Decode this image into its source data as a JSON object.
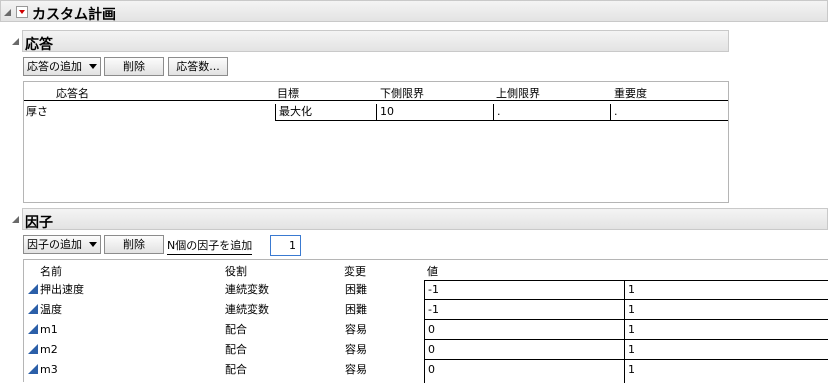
{
  "main": {
    "title": "カスタム計画"
  },
  "responses": {
    "title": "応答",
    "buttons": {
      "add": "応答の追加",
      "delete": "削除",
      "count": "応答数..."
    },
    "columns": [
      "応答名",
      "目標",
      "下側限界",
      "上側限界",
      "重要度"
    ],
    "rows": [
      {
        "name": "厚さ",
        "goal": "最大化",
        "lower": "10",
        "upper": ".",
        "importance": "."
      }
    ]
  },
  "factors": {
    "title": "因子",
    "buttons": {
      "add": "因子の追加",
      "delete": "削除",
      "add_n": "N個の因子を追加"
    },
    "n_value": "1",
    "columns": [
      "名前",
      "役割",
      "変更",
      "値"
    ],
    "rows": [
      {
        "name": "押出速度",
        "role": "連続変数",
        "change": "困難",
        "low": "-1",
        "high": "1"
      },
      {
        "name": "温度",
        "role": "連続変数",
        "change": "困難",
        "low": "-1",
        "high": "1"
      },
      {
        "name": "m1",
        "role": "配合",
        "change": "容易",
        "low": "0",
        "high": "1"
      },
      {
        "name": "m2",
        "role": "配合",
        "change": "容易",
        "low": "0",
        "high": "1"
      },
      {
        "name": "m3",
        "role": "配合",
        "change": "容易",
        "low": "0",
        "high": "1"
      }
    ]
  },
  "icons": {
    "hotspot": "red-triangle-menu-icon",
    "disclosure": "disclosure-triangle-icon",
    "factor": "continuous-factor-icon"
  },
  "colors": {
    "hotspot_red": "#d00000",
    "factor_icon_blue": "#2b5fa8",
    "focus_blue": "#3a7ad1"
  }
}
